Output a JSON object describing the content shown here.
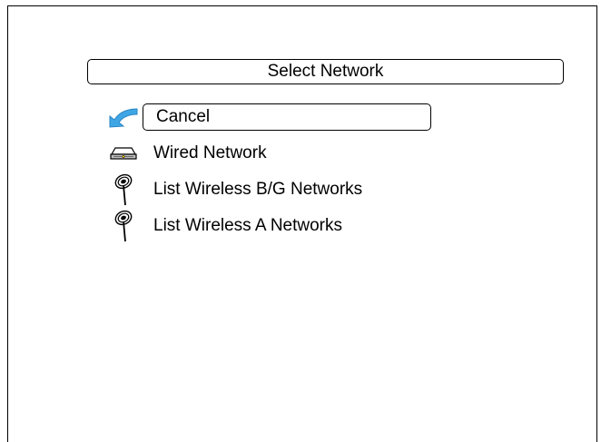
{
  "dialog": {
    "title": "Select Network"
  },
  "menu": {
    "items": [
      {
        "label": "Cancel",
        "icon": "back-arrow-icon",
        "selected": true
      },
      {
        "label": "Wired Network",
        "icon": "ethernet-device-icon",
        "selected": false
      },
      {
        "label": "List Wireless B/G Networks",
        "icon": "wireless-antenna-icon",
        "selected": false
      },
      {
        "label": "List Wireless A Networks",
        "icon": "wireless-antenna-icon",
        "selected": false
      }
    ]
  },
  "colors": {
    "background": "#ffffff",
    "text": "#000000",
    "accent_arrow": "#3fa6e6"
  }
}
